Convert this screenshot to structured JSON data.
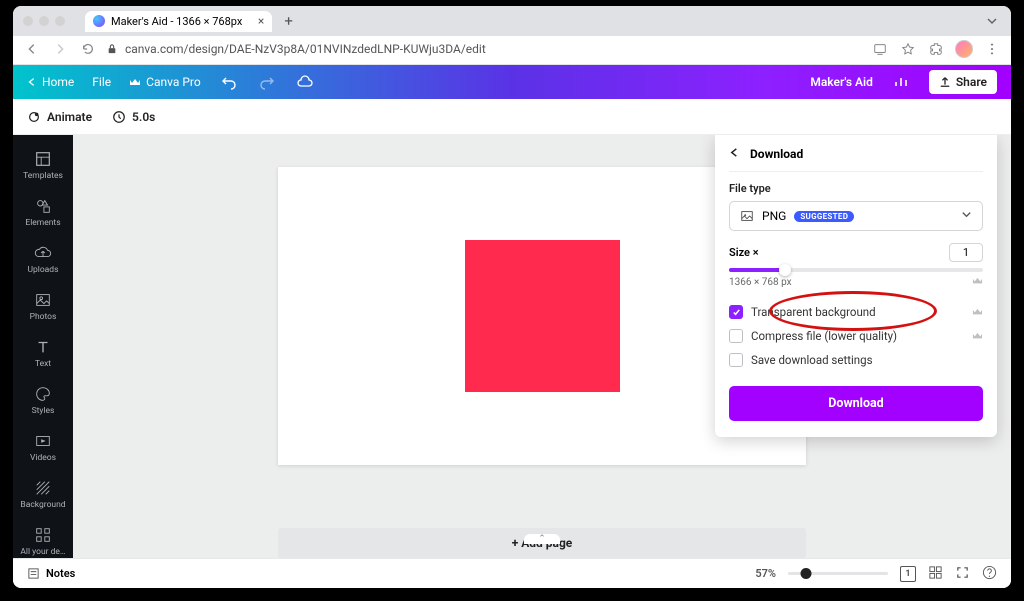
{
  "browser": {
    "tab_title": "Maker's Aid - 1366 × 768px",
    "url": "canva.com/design/DAE-NzV3p8A/01NVINzdedLNP-KUWju3DA/edit"
  },
  "apphdr": {
    "home": "Home",
    "file": "File",
    "canva_pro": "Canva Pro",
    "project_name": "Maker's Aid",
    "share": "Share"
  },
  "toolbar2": {
    "animate": "Animate",
    "duration": "5.0s"
  },
  "leftnav": {
    "templates": "Templates",
    "elements": "Elements",
    "uploads": "Uploads",
    "photos": "Photos",
    "text": "Text",
    "styles": "Styles",
    "videos": "Videos",
    "background": "Background",
    "more": "All your de…"
  },
  "canvas": {
    "add_page": "+ Add page"
  },
  "download": {
    "title": "Download",
    "file_type_label": "File type",
    "file_type_value": "PNG",
    "suggested": "SUGGESTED",
    "size_label": "Size ×",
    "size_value": "1",
    "dims": "1366 × 768 px",
    "opt_transparent": "Transparent background",
    "opt_compress": "Compress file (lower quality)",
    "opt_save": "Save download settings",
    "button": "Download"
  },
  "footer": {
    "notes": "Notes",
    "zoom": "57%",
    "page_count": "1"
  }
}
